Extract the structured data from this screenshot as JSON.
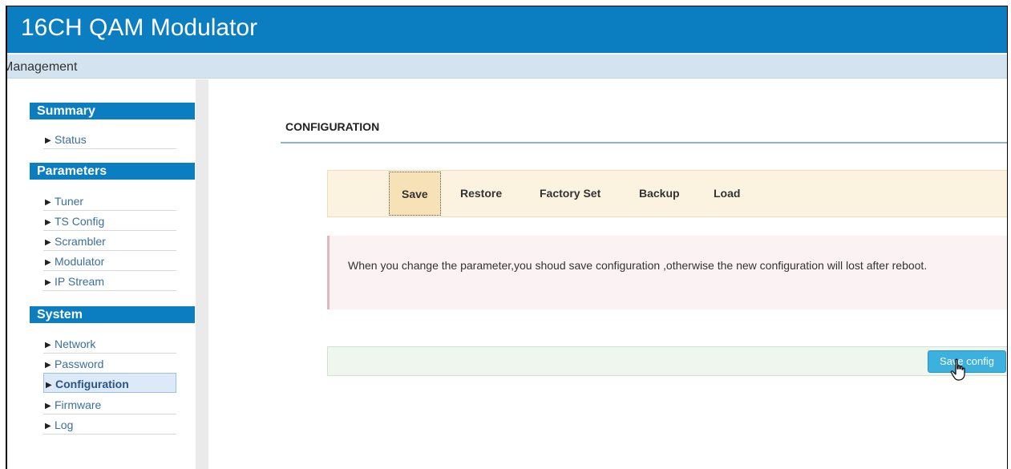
{
  "header": {
    "title": "16CH QAM Modulator"
  },
  "subbar": {
    "label": "Management"
  },
  "sidebar": {
    "sections": [
      {
        "title": "Summary",
        "items": [
          "Status"
        ]
      },
      {
        "title": "Parameters",
        "items": [
          "Tuner",
          "TS Config",
          "Scrambler",
          "Modulator",
          "IP Stream"
        ]
      },
      {
        "title": "System",
        "items": [
          "Network",
          "Password",
          "Configuration",
          "Firmware",
          "Log"
        ]
      }
    ],
    "active_item": "Configuration",
    "arrow_icon": "triangle-right-icon"
  },
  "main": {
    "page_title": "CONFIGURATION",
    "tabs": [
      "Save",
      "Restore",
      "Factory Set",
      "Backup",
      "Load"
    ],
    "active_tab": "Save",
    "alert_text": "When you change the parameter,you shoud save configuration ,otherwise the new configuration will lost after reboot.",
    "save_button": "Save config"
  },
  "colors": {
    "header": "#0a7ec0",
    "subbar": "#d3e3ef",
    "tabbar_bg": "#fbf3df",
    "alert_bg": "#fbf3f3",
    "action_bg": "#eff6ee",
    "button": "#3cb0df"
  }
}
